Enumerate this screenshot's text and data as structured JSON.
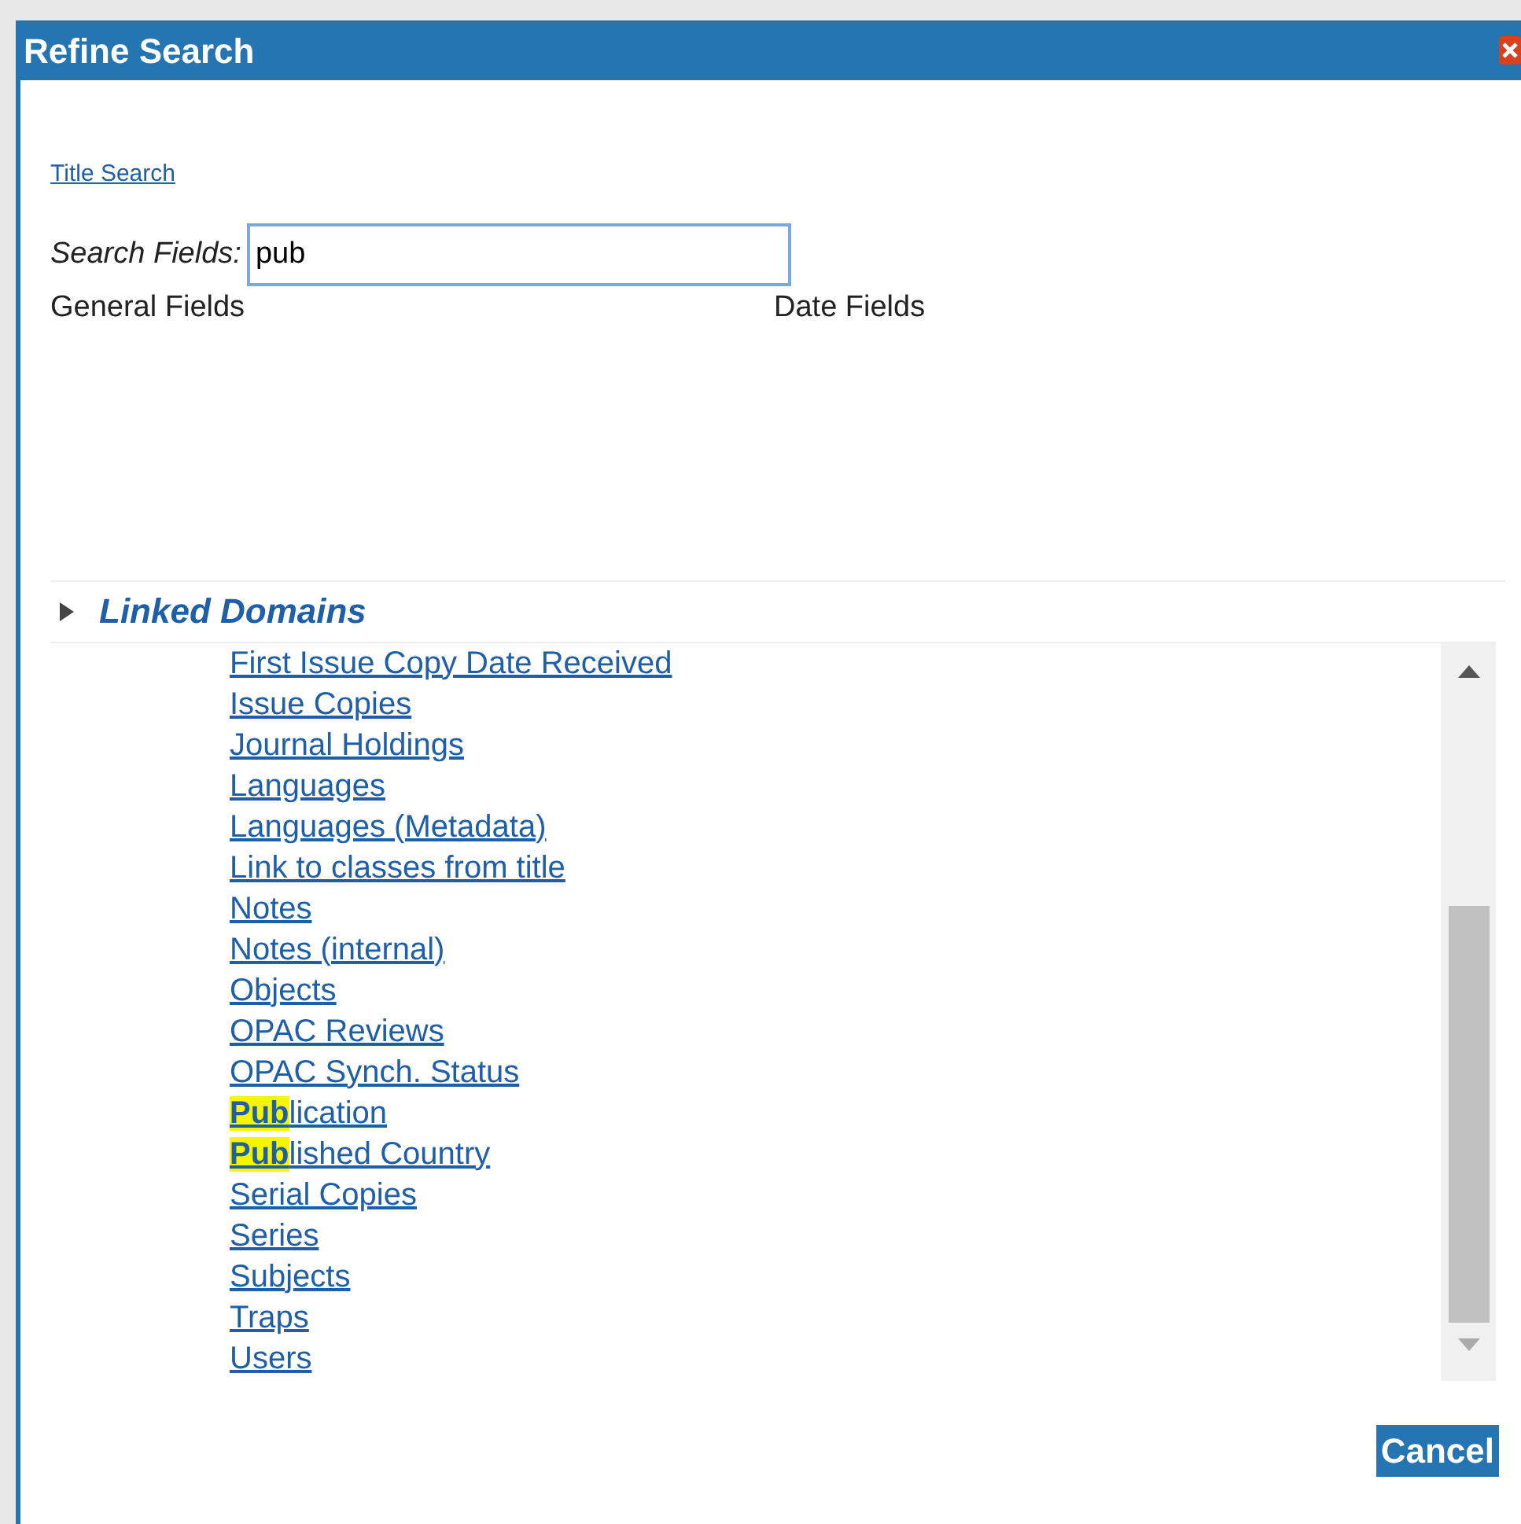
{
  "dialog": {
    "title": "Refine Search"
  },
  "title_search_link": "Title Search",
  "search": {
    "label": "Search Fields:",
    "value": "pub"
  },
  "columns": [
    "General Fields",
    "Date Fields"
  ],
  "linked_domains": {
    "title": "Linked Domains",
    "expanded": false,
    "items": [
      {
        "text": "First Issue Copy Date Received"
      },
      {
        "text": "Issue Copies"
      },
      {
        "text": "Journal Holdings"
      },
      {
        "text": "Languages"
      },
      {
        "text": "Languages (Metadata)"
      },
      {
        "text": "Link to classes from title"
      },
      {
        "text": "Notes"
      },
      {
        "text": "Notes (internal)"
      },
      {
        "text": "Objects"
      },
      {
        "text": "OPAC Reviews"
      },
      {
        "text": "OPAC Synch. Status"
      },
      {
        "match": "Pub",
        "text": "lication"
      },
      {
        "match": "Pub",
        "text": "lished Country"
      },
      {
        "text": "Serial Copies"
      },
      {
        "text": "Series"
      },
      {
        "text": "Subjects"
      },
      {
        "text": "Traps"
      },
      {
        "text": "Users"
      }
    ]
  },
  "buttons": {
    "cancel": "Cancel"
  }
}
